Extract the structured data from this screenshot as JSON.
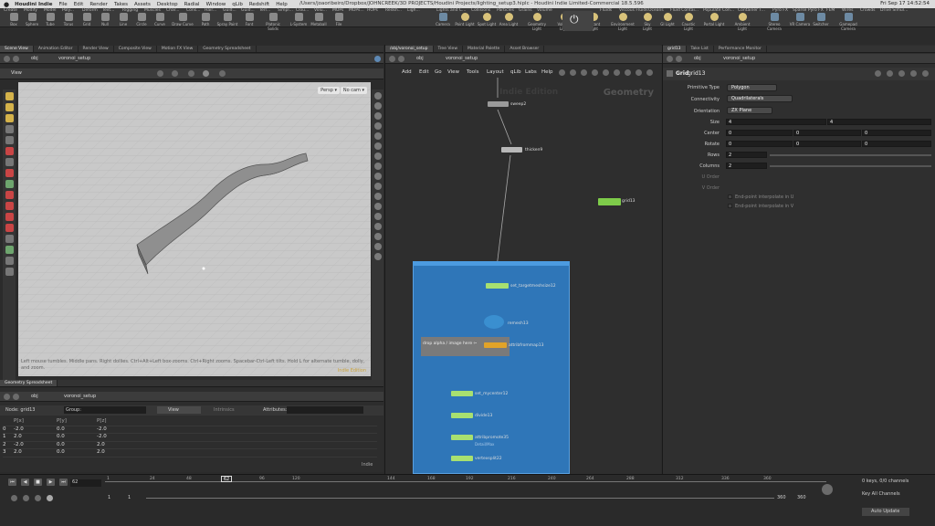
{
  "mac": {
    "app": "Houdini Indie",
    "menus": [
      "File",
      "Edit",
      "Render",
      "Takes",
      "Assets",
      "Desktop",
      "Radial",
      "Window",
      "qLib",
      "Redshift",
      "Help"
    ],
    "title": "/Users/joaoribeiro/Dropbox/JOHNCREEK/3D PROJECTS/Houdini Projects/lighting_setup3.hiplc - Houdini Indie Limited-Commercial 18.5.596",
    "clock": "Fri Sep 17 14:52:54"
  },
  "houdini_menus": [
    "Create",
    "Modify",
    "Model",
    "Poly...",
    "Deform",
    "Text...",
    "Rigging",
    "Muscles",
    "Char...",
    "Cons...",
    "Hair...",
    "Guid...",
    "Guid...",
    "Terr...",
    "Simpl...",
    "Clou...",
    "Volu...",
    "MOPs",
    "MOPs...",
    "HOPs",
    "Redsh...",
    "Ligh...",
    "Lights and C...",
    "Collisions",
    "Particles",
    "Grains",
    "Volume",
    "Rigid...",
    "Particl...",
    "Visc...",
    "Oceans",
    "FEM",
    "Fluids",
    "Viscous Fluids",
    "Oceans",
    "Fluid Contai...",
    "Populate Con...",
    "Container T...",
    "Pyro FX",
    "Sparse Pyro FX",
    "FEM",
    "Wires",
    "Crowds",
    "Drive Simul..."
  ],
  "shelf_tools": [
    "Box",
    "Sphere",
    "Tube",
    "Torus",
    "Grid",
    "Null",
    "Line",
    "Circle",
    "Curve",
    "Draw Curve",
    "Path",
    "Spray Paint",
    "Font",
    "Platonic Solids",
    "L-System",
    "Metaball",
    "File"
  ],
  "light_tools": [
    "Camera",
    "Point Light",
    "Spot Light",
    "Area Light",
    "Geometry Light",
    "Volume Light",
    "Distant Light",
    "Environment Light",
    "Sky Light",
    "GI Light",
    "Caustic Light",
    "Portal Light",
    "Ambient Light",
    "Stereo Camera",
    "VR Camera",
    "Switcher",
    "Gamepad Camera"
  ],
  "left_tabs": [
    "Scene View",
    "Animation Editor",
    "Render View",
    "Composite View",
    "Motion FX View",
    "Geometry Spreadsheet"
  ],
  "left_path": {
    "root": "obj",
    "node": "voronoi_setup"
  },
  "viewport": {
    "label": "View",
    "persp": "Persp ▾",
    "cam": "No cam ▾",
    "hint": "Left mouse tumbles. Middle pans. Right dollies. Ctrl+Alt+Left box-zooms. Ctrl+Right zooms. Spacebar-Ctrl-Left tilts. Hold L for alternate tumble, dolly, and zoom.",
    "mode": "Indie Edition"
  },
  "sheet": {
    "tab": "Geometry Spreadsheet",
    "path_root": "obj",
    "path_node": "voronoi_setup",
    "node_label": "Node: grid13",
    "group_label": "Group:",
    "view": "View",
    "intrinsics": "Intrinsics",
    "attributes": "Attributes:",
    "headers": [
      "",
      "P[x]",
      "P[y]",
      "P[z]"
    ],
    "rows": [
      [
        "0",
        "-2.0",
        "0.0",
        "-2.0"
      ],
      [
        "1",
        "2.0",
        "0.0",
        "-2.0"
      ],
      [
        "2",
        "-2.0",
        "0.0",
        "2.0"
      ],
      [
        "3",
        "2.0",
        "0.0",
        "2.0"
      ]
    ],
    "footer": "Indie"
  },
  "net_tabs": [
    "/obj/voronoi_setup",
    "Tree View",
    "Material Palette",
    "Asset Browser"
  ],
  "net_path": {
    "root": "obj",
    "node": "voronoi_setup"
  },
  "net_menu": [
    "Add",
    "Edit",
    "Go",
    "View",
    "Tools",
    "Layout",
    "qLib",
    "Labs",
    "Help"
  ],
  "net_context": "Geometry",
  "net_watermark": "Indie Edition",
  "nodes": {
    "sweep": "sweep2",
    "thicken": "thicken9",
    "grid": "grid13",
    "set_target": "set_targetmeshsize12",
    "remesh": "remesh13",
    "attribfrommap": "attribfrommap13",
    "sticky": "drop alpha / image here ⇦",
    "set_center": "set_mycenter12",
    "divide": "divide13",
    "attribpromote": "attribpromote35",
    "attribpromote_sub": "Detail/Max",
    "vertexsplit": "vertexsplit22"
  },
  "param_tabs": [
    "grid13",
    "Take List",
    "Performance Monitor"
  ],
  "param_header": {
    "type": "Grid",
    "name": "grid13"
  },
  "params": {
    "primitive_type": {
      "label": "Primitive Type",
      "value": "Polygon"
    },
    "connectivity": {
      "label": "Connectivity",
      "value": "Quadrilaterals"
    },
    "orientation": {
      "label": "Orientation",
      "value": "ZX Plane"
    },
    "size": {
      "label": "Size",
      "x": "4",
      "y": "4"
    },
    "center": {
      "label": "Center",
      "x": "0",
      "y": "0",
      "z": "0"
    },
    "rotate": {
      "label": "Rotate",
      "x": "0",
      "y": "0",
      "z": "0"
    },
    "rows": {
      "label": "Rows",
      "value": "2"
    },
    "columns": {
      "label": "Columns",
      "value": "2"
    },
    "u_order": "U Order",
    "v_order": "V Order",
    "interp_u": "End-point interpolate in U",
    "interp_v": "End-point interpolate in V"
  },
  "timeline": {
    "frame": "62",
    "ticks": [
      "1",
      "24",
      "48",
      "72",
      "96",
      "120",
      "144",
      "168",
      "192",
      "216",
      "240",
      "264",
      "288",
      "312",
      "336",
      "360"
    ],
    "current": "62",
    "start": "1",
    "start2": "1",
    "end": "360",
    "end2": "360",
    "keys": "0 keys, 0/0 channels",
    "key_all": "Key All Channels",
    "auto_update": "Auto Update"
  }
}
